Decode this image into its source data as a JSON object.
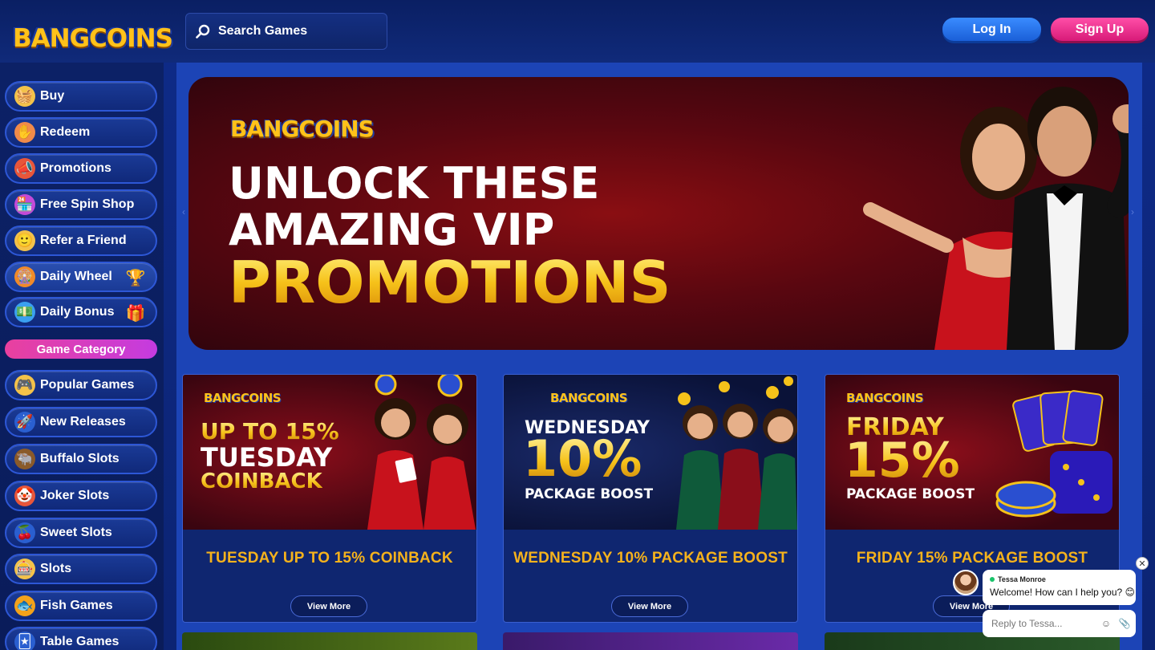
{
  "brand": {
    "logo_text": "BANGCOINS"
  },
  "search": {
    "placeholder": "Search Games"
  },
  "auth": {
    "login_label": "Log In",
    "signup_label": "Sign Up"
  },
  "sidebar": {
    "items": [
      {
        "label": "Buy",
        "icon": "basket-icon"
      },
      {
        "label": "Redeem",
        "icon": "redeem-hand-icon"
      },
      {
        "label": "Promotions",
        "icon": "megaphone-icon"
      },
      {
        "label": "Free Spin Shop",
        "icon": "shop-icon"
      },
      {
        "label": "Refer a Friend",
        "icon": "friend-icon"
      },
      {
        "label": "Daily Wheel",
        "icon": "wheel-icon",
        "trail_icon": "trophy-icon"
      },
      {
        "label": "Daily Bonus",
        "icon": "bonus-icon",
        "trail_icon": "gift-icon"
      }
    ],
    "category_header": "Game Category",
    "categories": [
      {
        "label": "Popular Games",
        "icon": "gamepad-icon"
      },
      {
        "label": "New Releases",
        "icon": "rocket-icon"
      },
      {
        "label": "Buffalo Slots",
        "icon": "buffalo-icon"
      },
      {
        "label": "Joker Slots",
        "icon": "joker-icon"
      },
      {
        "label": "Sweet Slots",
        "icon": "cherry-icon"
      },
      {
        "label": "Slots",
        "icon": "slot-machine-icon"
      },
      {
        "label": "Fish Games",
        "icon": "fish-icon"
      },
      {
        "label": "Table Games",
        "icon": "cards-icon"
      }
    ]
  },
  "hero": {
    "logo_text": "BANGCOINS",
    "line1": "UNLOCK THESE",
    "line2": "AMAZING VIP",
    "line3": "PROMOTIONS"
  },
  "promos": [
    {
      "img_logo": "BANGCOINS",
      "img_lines": [
        "UP TO 15%",
        "TUESDAY",
        "COINBACK"
      ],
      "title": "TUESDAY UP TO 15% COINBACK",
      "button": "View More"
    },
    {
      "img_logo": "BANGCOINS",
      "img_lines": [
        "WEDNESDAY",
        "10%",
        "PACKAGE BOOST"
      ],
      "title": "WEDNESDAY 10% PACKAGE BOOST",
      "button": "View More"
    },
    {
      "img_logo": "BANGCOINS",
      "img_lines": [
        "FRIDAY",
        "15%",
        "PACKAGE BOOST"
      ],
      "title": "FRIDAY 15% PACKAGE BOOST",
      "button": "View More"
    }
  ],
  "chat": {
    "agent_name": "Tessa Monroe",
    "message": "Welcome! How can I help you? 😊",
    "placeholder": "Reply to Tessa..."
  },
  "colors": {
    "accent_gold": "#f5b21c",
    "login_blue": "#2a75f0",
    "signup_pink": "#e9409e",
    "sidebar_border": "#2d57d6"
  }
}
